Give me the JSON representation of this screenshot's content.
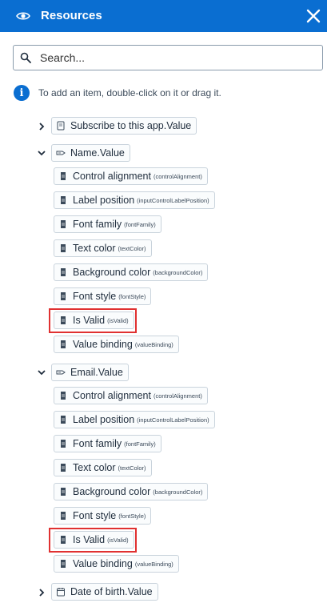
{
  "header": {
    "title": "Resources",
    "eye_icon": "eye-icon",
    "close_icon": "close-icon",
    "background_color": "#0a6ed1"
  },
  "search": {
    "placeholder": "Search..."
  },
  "info": {
    "text": "To add an item, double-click on it or drag it."
  },
  "tree": {
    "subscribe": {
      "label": "Subscribe to this app.Value",
      "expanded": false
    },
    "name_group": {
      "label": "Name.Value",
      "expanded": true,
      "items": [
        {
          "label": "Control alignment",
          "key": "(controlAlignment)"
        },
        {
          "label": "Label position",
          "key": "(inputControlLabelPosition)"
        },
        {
          "label": "Font family",
          "key": "(fontFamily)"
        },
        {
          "label": "Text color",
          "key": "(textColor)"
        },
        {
          "label": "Background color",
          "key": "(backgroundColor)"
        },
        {
          "label": "Font style",
          "key": "(fontStyle)"
        },
        {
          "label": "Is Valid",
          "key": "(isValid)"
        },
        {
          "label": "Value binding",
          "key": "(valueBinding)"
        }
      ]
    },
    "email_group": {
      "label": "Email.Value",
      "expanded": true,
      "items": [
        {
          "label": "Control alignment",
          "key": "(controlAlignment)"
        },
        {
          "label": "Label position",
          "key": "(inputControlLabelPosition)"
        },
        {
          "label": "Font family",
          "key": "(fontFamily)"
        },
        {
          "label": "Text color",
          "key": "(textColor)"
        },
        {
          "label": "Background color",
          "key": "(backgroundColor)"
        },
        {
          "label": "Font style",
          "key": "(fontStyle)"
        },
        {
          "label": "Is Valid",
          "key": "(isValid)"
        },
        {
          "label": "Value binding",
          "key": "(valueBinding)"
        }
      ]
    },
    "dob": {
      "label": "Date of birth.Value",
      "expanded": false
    }
  },
  "highlight_color": "#e03131"
}
